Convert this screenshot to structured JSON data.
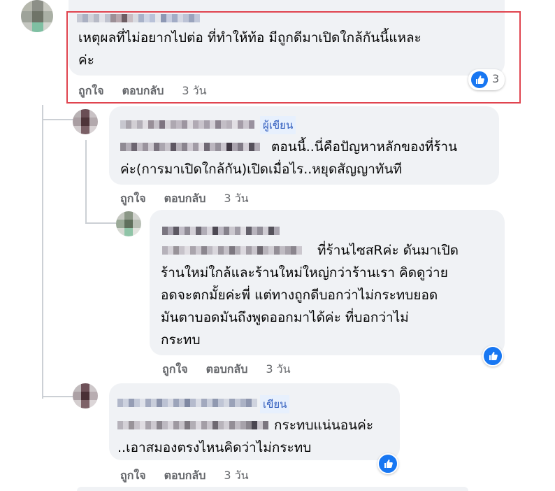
{
  "comments": [
    {
      "author_tag": "",
      "text": "เหตุผลที่ไม่อยากไปต่อ ที่ทำให้ท้อ มีถูกดีมาเปิดใกล้กันนี้แหละ\nค่ะ",
      "like": "ถูกใจ",
      "reply": "ตอบกลับ",
      "time": "3 วัน",
      "reaction_count": "3",
      "reaction_icon": "thumbs-up-icon"
    },
    {
      "author_tag": "ผู้เขียน",
      "text_line1": "ตอนนี้..นี่คือปัญหาหลักของที่ร้าน",
      "text_line2": "ค่ะ(การมาเปิดใกล้กัน)เปิดเมื่อไร..หยุดสัญญาทันที",
      "like": "ถูกใจ",
      "reply": "ตอบกลับ",
      "time": "3 วัน"
    },
    {
      "text_line1": "ที่ร้านไซสRค่ะ ดันมาเปิด",
      "text_rest": "ร้านใหม่ใกล้และร้านใหม่ใหญ่กว่าร้านเรา คิดดูว่าย\nอดจะตกมั้ยค่ะพี่ แต่ทางถูกดีบอกว่าไม่กระทบยอด\nมันตาบอดมันถึงพูดออกมาได้ค่ะ ที่บอกว่าไม่\nกระทบ",
      "like": "ถูกใจ",
      "reply": "ตอบกลับ",
      "time": "3 วัน",
      "reaction_icon": "thumbs-up-icon"
    },
    {
      "author_tag": "เขียน",
      "text_line1": "กระทบแน่นอนค่ะ",
      "text_line2": "..เอาสมองตรงไหนคิดว่าไม่กระทบ",
      "like": "ถูกใจ",
      "reply": "ตอบกลับ",
      "time": "3 วัน",
      "reaction_icon": "thumbs-up-icon"
    }
  ],
  "colors": {
    "bubble": "#f0f2f5",
    "accent_blue": "#1877f2",
    "highlight_red": "#e0444f",
    "meta_gray": "#65676b"
  }
}
